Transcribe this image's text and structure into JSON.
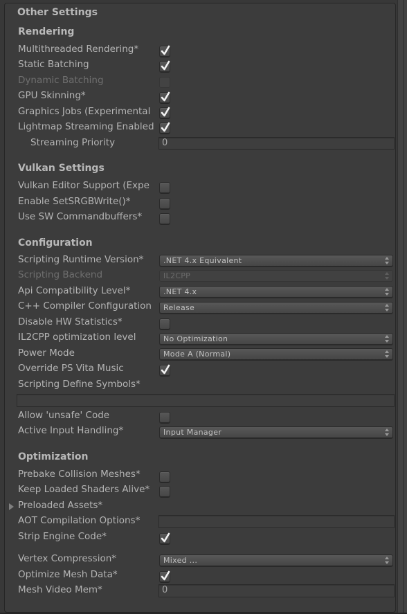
{
  "panel": {
    "title": "Other Settings"
  },
  "rendering": {
    "header": "Rendering",
    "multithreaded_rendering": {
      "label": "Multithreaded Rendering*",
      "checked": true
    },
    "static_batching": {
      "label": "Static Batching",
      "checked": true
    },
    "dynamic_batching": {
      "label": "Dynamic Batching",
      "checked": false,
      "disabled": true
    },
    "gpu_skinning": {
      "label": "GPU Skinning*",
      "checked": true
    },
    "graphics_jobs": {
      "label": "Graphics Jobs (Experimental",
      "checked": true
    },
    "lightmap_streaming": {
      "label": "Lightmap Streaming Enabled",
      "checked": true
    },
    "streaming_priority": {
      "label": "Streaming Priority",
      "value": "0"
    }
  },
  "vulkan": {
    "header": "Vulkan Settings",
    "editor_support": {
      "label": "Vulkan Editor Support (Expe",
      "checked": false
    },
    "set_srgb_write": {
      "label": "Enable SetSRGBWrite()*",
      "checked": false
    },
    "sw_commandbuffers": {
      "label": "Use SW Commandbuffers*",
      "checked": false
    }
  },
  "configuration": {
    "header": "Configuration",
    "scripting_runtime": {
      "label": "Scripting Runtime Version*",
      "value": ".NET 4.x Equivalent"
    },
    "scripting_backend": {
      "label": "Scripting Backend",
      "value": "IL2CPP",
      "disabled": true
    },
    "api_compat": {
      "label": "Api Compatibility Level*",
      "value": ".NET 4.x"
    },
    "cpp_compiler": {
      "label": "C++ Compiler Configuration",
      "value": "Release"
    },
    "disable_hw_stats": {
      "label": "Disable HW Statistics*",
      "checked": false
    },
    "il2cpp_opt": {
      "label": "IL2CPP optimization level",
      "value": "No Optimization"
    },
    "power_mode": {
      "label": "Power Mode",
      "value": "Mode A (Normal)"
    },
    "override_vita_music": {
      "label": "Override PS Vita Music",
      "checked": true
    },
    "define_symbols": {
      "label": "Scripting Define Symbols*",
      "value": ""
    },
    "allow_unsafe": {
      "label": "Allow 'unsafe' Code",
      "checked": false
    },
    "active_input": {
      "label": "Active Input Handling*",
      "value": "Input Manager"
    }
  },
  "optimization": {
    "header": "Optimization",
    "prebake_collision": {
      "label": "Prebake Collision Meshes*",
      "checked": false
    },
    "keep_shaders": {
      "label": "Keep Loaded Shaders Alive*",
      "checked": false
    },
    "preloaded_assets": {
      "label": "Preloaded Assets*",
      "expanded": false
    },
    "aot_options": {
      "label": "AOT Compilation Options*",
      "value": ""
    },
    "strip_engine": {
      "label": "Strip Engine Code*",
      "checked": true
    },
    "vertex_compression": {
      "label": "Vertex Compression*",
      "value": "Mixed ..."
    },
    "optimize_mesh": {
      "label": "Optimize Mesh Data*",
      "checked": true
    },
    "mesh_video_mem": {
      "label": "Mesh Video Mem*",
      "value": "0"
    }
  }
}
